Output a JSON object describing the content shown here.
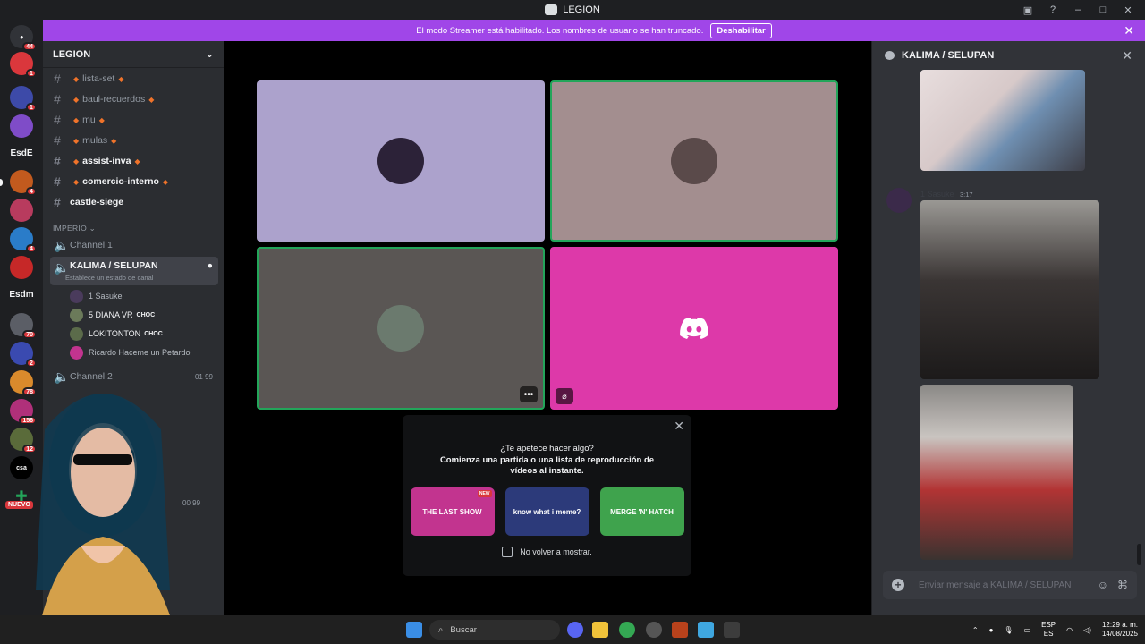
{
  "window": {
    "title": "LEGION"
  },
  "banner": {
    "text": "El modo Streamer está habilitado. Los nombres de usuario se han truncado.",
    "button": "Deshabilitar"
  },
  "servers": {
    "items": [
      {
        "name": "server-1",
        "badge": "44",
        "color": "#313338"
      },
      {
        "name": "server-2",
        "badge": "1",
        "color": "#da373c"
      },
      {
        "name": "server-vox",
        "badge": "1",
        "color": "#3d4aa8"
      },
      {
        "name": "server-4",
        "badge": "",
        "color": "#7f4cc8"
      },
      {
        "name": "server-6",
        "badge": "4",
        "color": "#c25a1e"
      },
      {
        "name": "server-7",
        "badge": "",
        "color": "#b83b5e"
      },
      {
        "name": "server-8",
        "badge": "4",
        "color": "#2a7cc9"
      },
      {
        "name": "server-9",
        "badge": "",
        "color": "#c62828"
      },
      {
        "name": "server-11",
        "badge": "70",
        "color": "#5b5e66"
      },
      {
        "name": "server-12",
        "badge": "2",
        "color": "#3a4ab0"
      },
      {
        "name": "server-13",
        "badge": "78",
        "color": "#d98a2c"
      },
      {
        "name": "server-14",
        "badge": "156",
        "color": "#b0307a"
      },
      {
        "name": "server-15",
        "badge": "12",
        "color": "#5a6b3a"
      }
    ],
    "text_items": [
      "EsdE",
      "Esdm",
      "csa"
    ],
    "new_label": "NUEVO"
  },
  "sidebar": {
    "server_name": "LEGION",
    "text_channels": [
      {
        "label": "lista-set",
        "bold": false
      },
      {
        "label": "baul-recuerdos",
        "bold": false
      },
      {
        "label": "mu",
        "bold": false
      },
      {
        "label": "mulas",
        "bold": false
      },
      {
        "label": "assist-inva",
        "bold": true
      },
      {
        "label": "comercio-interno",
        "bold": true
      },
      {
        "label": "castle-siege",
        "bold": true
      }
    ],
    "category": "IMPERIO",
    "voice_channel_1": "Channel 1",
    "selected_channel": "KALIMA / SELUPAN",
    "selected_status": "Establece un estado de canal",
    "voice_users": [
      {
        "name": "1 Sasuke",
        "tag": "",
        "color": "#4a3b5c"
      },
      {
        "name": "5 DIANA VR",
        "tag": "CHOC",
        "color": "#6b7a5a"
      },
      {
        "name": "LOKITONTON",
        "tag": "CHOC",
        "color": "#5b6b4a"
      },
      {
        "name": "Ricardo Haceme un Petardo",
        "tag": "",
        "color": "#c2348f"
      }
    ],
    "voice_channel_2": "Channel 2",
    "counter_a": "01",
    "counter_b": "99",
    "counter_c": "00",
    "counter_d": "99"
  },
  "activity": {
    "title": "¿Te apetece hacer algo?",
    "subtitle": "Comienza una partida o una lista de reproducción de vídeos al instante.",
    "games": [
      {
        "name": "THE LAST SHOW",
        "new_label": "NEW",
        "color": "#c2348f"
      },
      {
        "name": "know what i meme?",
        "new_label": "",
        "color": "#2c3a7a"
      },
      {
        "name": "MERGE 'N' HATCH",
        "new_label": "",
        "color": "#3fa34d"
      }
    ],
    "checkbox_label": "No volver a mostrar."
  },
  "chat": {
    "title": "KALIMA / SELUPAN",
    "message_user": "1 Sasuke",
    "message_time": "3:17",
    "input_placeholder": "Enviar mensaje a KALIMA / SELUPAN"
  },
  "taskbar": {
    "search_placeholder": "Buscar",
    "lang_top": "ESP",
    "lang_bottom": "ES",
    "time": "12:29 a. m.",
    "date": "14/08/2025"
  },
  "colors": {
    "banner": "#a046e8",
    "tile_1": "#aca2cc",
    "tile_2": "#a38e8f",
    "tile_3": "#5a5654",
    "tile_4": "#dd39a9",
    "speaking": "#23a55a"
  }
}
